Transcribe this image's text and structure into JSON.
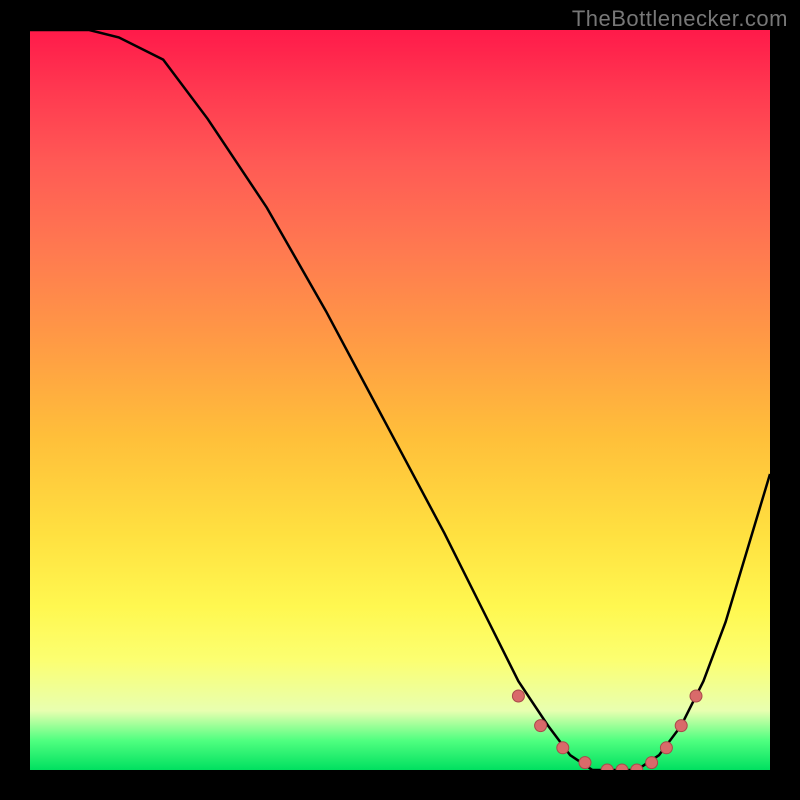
{
  "attribution": "TheBottlenecker.com",
  "colors": {
    "bg": "#000000",
    "curve": "#000000",
    "dots": "#d96a6a",
    "dots_stroke": "#a84a4a"
  },
  "chart_data": {
    "type": "line",
    "title": "",
    "xlabel": "",
    "ylabel": "",
    "xlim": [
      0,
      100
    ],
    "ylim": [
      0,
      100
    ],
    "x": [
      0,
      2,
      5,
      8,
      12,
      18,
      24,
      32,
      40,
      48,
      56,
      62,
      66,
      70,
      73,
      76,
      79,
      82,
      85,
      88,
      91,
      94,
      97,
      100
    ],
    "values": [
      100,
      100,
      100,
      100,
      99,
      96,
      88,
      76,
      62,
      47,
      32,
      20,
      12,
      6,
      2,
      0,
      0,
      0,
      2,
      6,
      12,
      20,
      30,
      40
    ],
    "dot_points_x": [
      66,
      69,
      72,
      75,
      78,
      80,
      82,
      84,
      86,
      88,
      90
    ],
    "dot_points_y": [
      10,
      6,
      3,
      1,
      0,
      0,
      0,
      1,
      3,
      6,
      10
    ]
  }
}
